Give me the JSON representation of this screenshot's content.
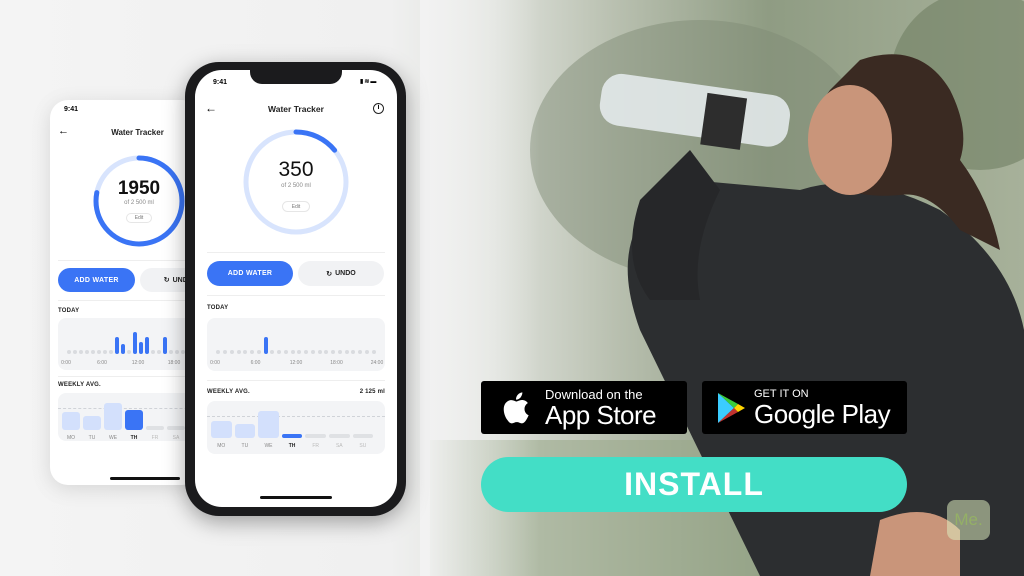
{
  "colors": {
    "accent": "#3a74f5",
    "ring_track": "#d8e4fd",
    "install": "#43dec6"
  },
  "front_phone": {
    "status_time": "9:41",
    "title": "Water Tracker",
    "icons": [
      "back-arrow-icon",
      "info-icon",
      "signal-icon",
      "wifi-icon",
      "battery-icon"
    ],
    "amount": "350",
    "amount_value": 350,
    "goal_label": "of 2 500 ml",
    "goal_value": 2500,
    "edit_label": "Edit",
    "add_label": "ADD WATER",
    "undo_label": "UNDO",
    "today_label": "TODAY",
    "today_ticks": [
      "0:00",
      "6:00",
      "12:00",
      "18:00",
      "24:00"
    ],
    "today_hourly_ml": {
      "7": 350
    },
    "weekly_label": "WEEKLY AVG.",
    "weekly_value": "2 125 ml",
    "weekly_avg_ml": 2125,
    "days": [
      "MO",
      "TU",
      "WE",
      "TH",
      "FR",
      "SA",
      "SU"
    ],
    "weekly_ml": [
      1650,
      1350,
      2600,
      350,
      0,
      0,
      0
    ],
    "current_day": "TH"
  },
  "back_phone": {
    "status_time": "9:41",
    "title": "Water Tracker",
    "amount": "1950",
    "amount_value": 1950,
    "goal_label": "of 2 500 ml",
    "goal_value": 2500,
    "edit_label": "Edit",
    "add_label": "ADD WATER",
    "undo_label": "UNDO",
    "today_label": "TODAY",
    "today_ticks": [
      "0:00",
      "6:00",
      "12:00",
      "18:00"
    ],
    "today_hourly_ml": {
      "8": 350,
      "9": 200,
      "11": 450,
      "12": 250,
      "13": 350,
      "16": 350
    },
    "weekly_label": "WEEKLY AVG.",
    "weekly_avg_ml": 2125,
    "days": [
      "MO",
      "TU",
      "WE",
      "TH",
      "FR",
      "SA"
    ],
    "weekly_ml": [
      1700,
      1400,
      2600,
      1950,
      0,
      0
    ],
    "current_day": "TH"
  },
  "app_store": {
    "line1": "Download on the",
    "line2": "App Store"
  },
  "google_play": {
    "line1": "GET IT ON",
    "line2": "Google Play"
  },
  "install_label": "INSTALL",
  "logo": "Me."
}
